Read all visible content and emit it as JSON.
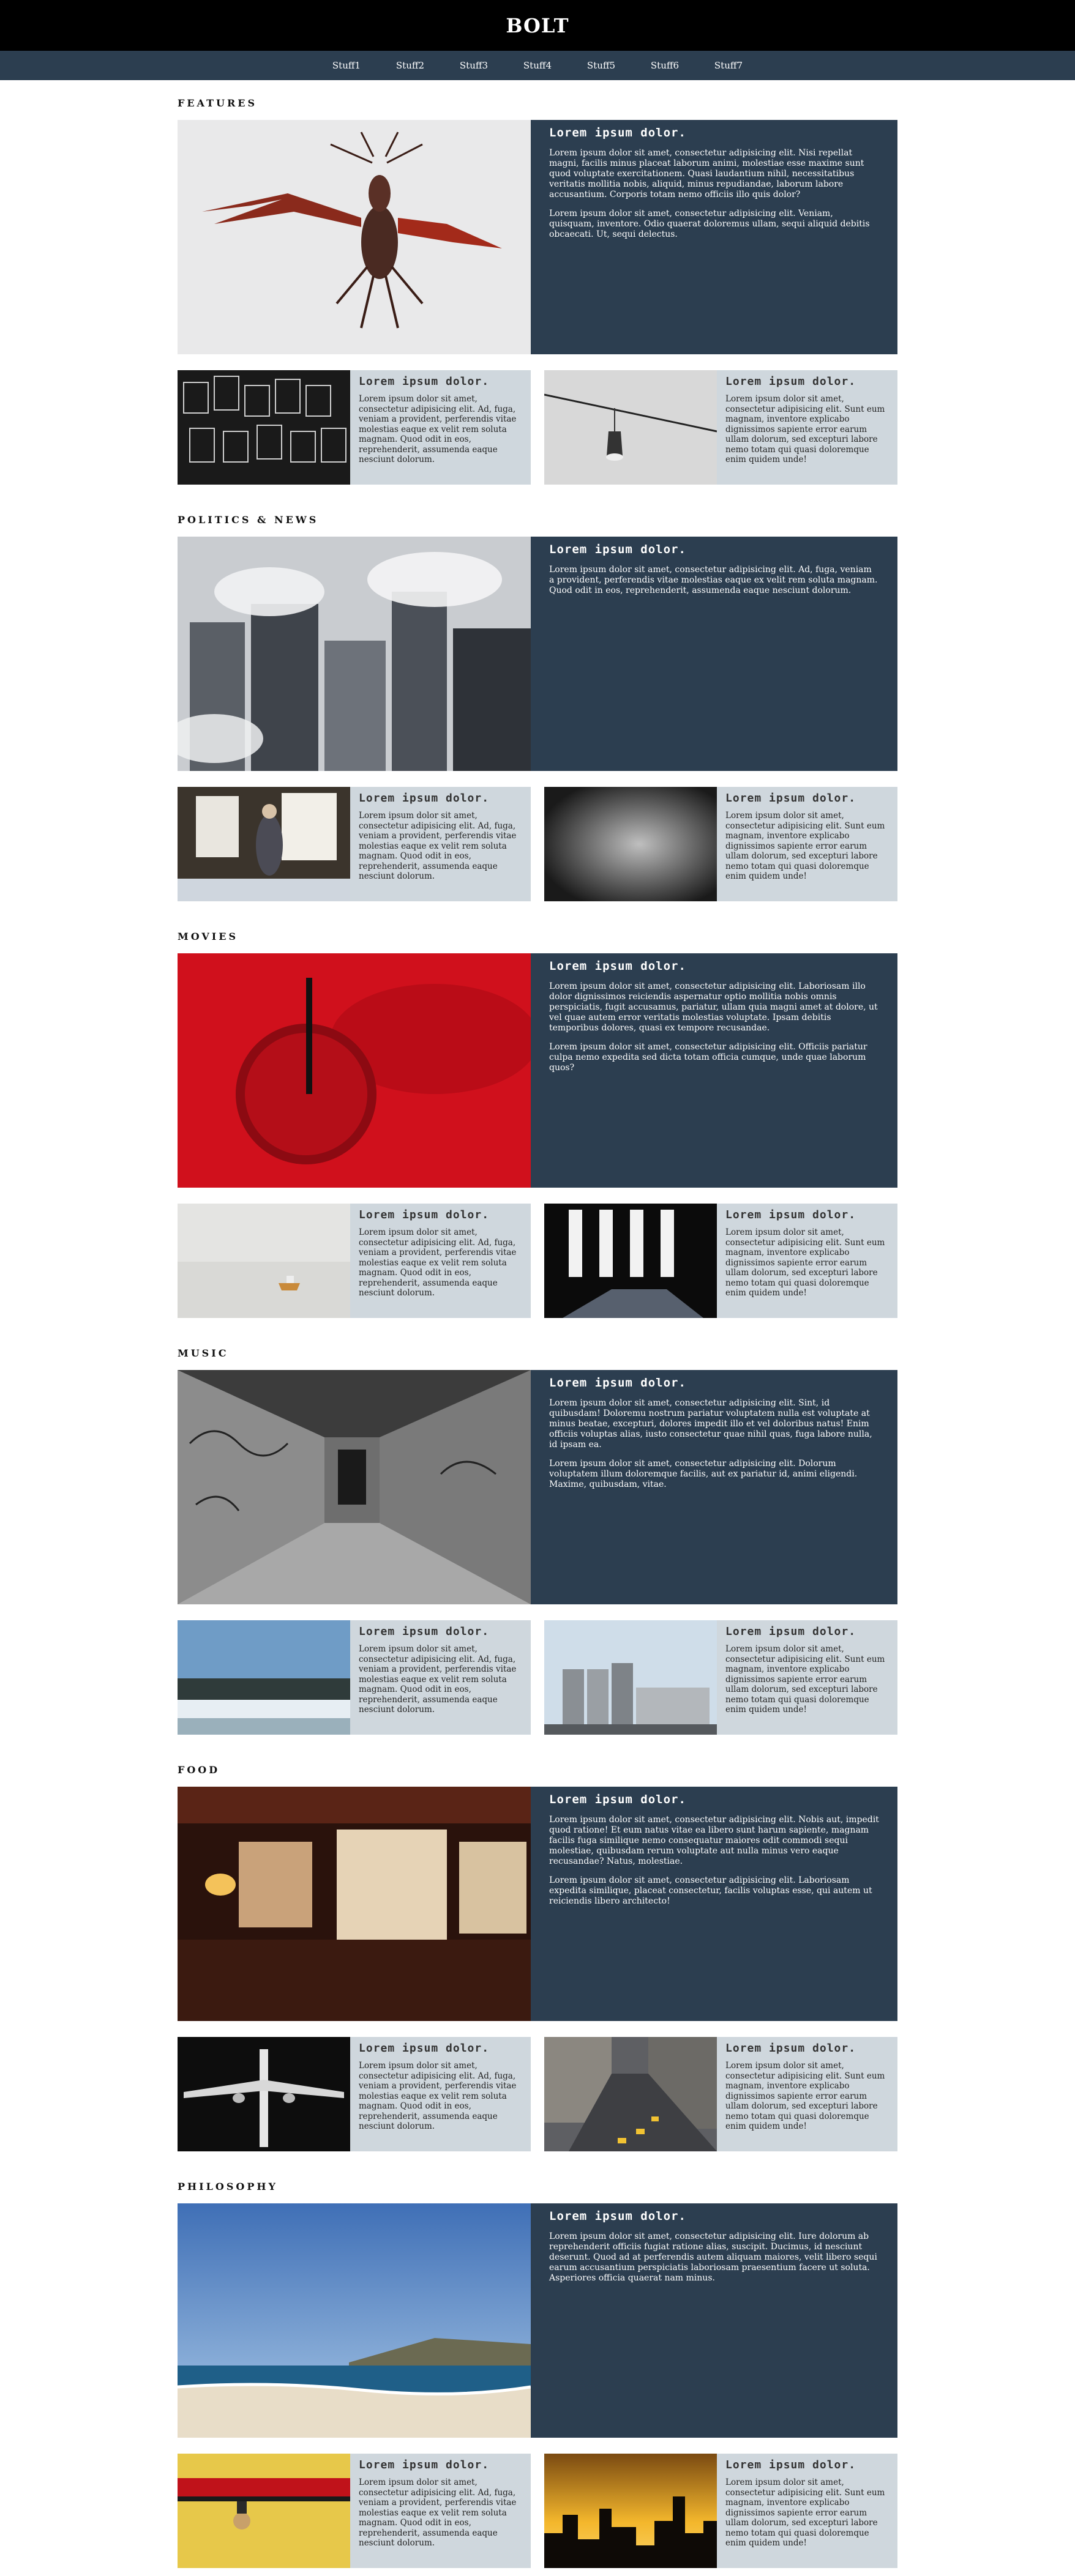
{
  "brand": "BOLT",
  "nav": [
    "Stuff1",
    "Stuff2",
    "Stuff3",
    "Stuff4",
    "Stuff5",
    "Stuff6",
    "Stuff7"
  ],
  "sections": [
    {
      "title": "FEATURES",
      "feature": {
        "heading": "Lorem ipsum dolor.",
        "paragraphs": [
          "Lorem ipsum dolor sit amet, consectetur adipisicing elit. Nisi repellat magni, facilis minus placeat laborum animi, molestiae esse maxime sunt quod voluptate exercitationem. Quasi laudantium nihil, necessitatibus veritatis mollitia nobis, aliquid, minus repudiandae, laborum labore accusantium. Corporis totam nemo officiis illo quis dolor?",
          "Lorem ipsum dolor sit amet, consectetur adipisicing elit. Veniam, quisquam, inventore. Odio quaerat doloremus ullam, sequi aliquid debitis obcaecati. Ut, sequi delectus."
        ]
      },
      "cards": [
        {
          "heading": "Lorem ipsum dolor.",
          "text": "Lorem ipsum dolor sit amet, consectetur adipisicing elit. Ad, fuga, veniam a provident, perferendis vitae molestias eaque ex velit rem soluta magnam. Quod odit in eos, reprehenderit, assumenda eaque nesciunt dolorum."
        },
        {
          "heading": "Lorem ipsum dolor.",
          "text": "Lorem ipsum dolor sit amet, consectetur adipisicing elit. Sunt eum magnam, inventore explicabo dignissimos sapiente error earum ullam dolorum, sed excepturi labore nemo totam qui quasi doloremque enim quidem unde!"
        }
      ]
    },
    {
      "title": "POLITICS & NEWS",
      "feature": {
        "heading": "Lorem ipsum dolor.",
        "paragraphs": [
          "Lorem ipsum dolor sit amet, consectetur adipisicing elit. Ad, fuga, veniam a provident, perferendis vitae molestias eaque ex velit rem soluta magnam. Quod odit in eos, reprehenderit, assumenda eaque nesciunt dolorum."
        ]
      },
      "cards": [
        {
          "heading": "Lorem ipsum dolor.",
          "text": "Lorem ipsum dolor sit amet, consectetur adipisicing elit. Ad, fuga, veniam a provident, perferendis vitae molestias eaque ex velit rem soluta magnam. Quod odit in eos, reprehenderit, assumenda eaque nesciunt dolorum."
        },
        {
          "heading": "Lorem ipsum dolor.",
          "text": "Lorem ipsum dolor sit amet, consectetur adipisicing elit. Sunt eum magnam, inventore explicabo dignissimos sapiente error earum ullam dolorum, sed excepturi labore nemo totam qui quasi doloremque enim quidem unde!"
        }
      ]
    },
    {
      "title": "MOVIES",
      "feature": {
        "heading": "Lorem ipsum dolor.",
        "paragraphs": [
          "Lorem ipsum dolor sit amet, consectetur adipisicing elit. Laboriosam illo dolor dignissimos reiciendis aspernatur optio mollitia nobis omnis perspiciatis, fugit accusamus, pariatur, ullam quia magni amet at dolore, ut vel quae autem error veritatis molestias voluptate. Ipsam debitis temporibus dolores, quasi ex tempore recusandae.",
          "Lorem ipsum dolor sit amet, consectetur adipisicing elit. Officiis pariatur culpa nemo expedita sed dicta totam officia cumque, unde quae laborum quos?"
        ]
      },
      "cards": [
        {
          "heading": "Lorem ipsum dolor.",
          "text": "Lorem ipsum dolor sit amet, consectetur adipisicing elit. Ad, fuga, veniam a provident, perferendis vitae molestias eaque ex velit rem soluta magnam. Quod odit in eos, reprehenderit, assumenda eaque nesciunt dolorum."
        },
        {
          "heading": "Lorem ipsum dolor.",
          "text": "Lorem ipsum dolor sit amet, consectetur adipisicing elit. Sunt eum magnam, inventore explicabo dignissimos sapiente error earum ullam dolorum, sed excepturi labore nemo totam qui quasi doloremque enim quidem unde!"
        }
      ]
    },
    {
      "title": "MUSIC",
      "feature": {
        "heading": "Lorem ipsum dolor.",
        "paragraphs": [
          "Lorem ipsum dolor sit amet, consectetur adipisicing elit. Sint, id quibusdam! Doloremu nostrum pariatur voluptatem nulla est voluptate at minus beatae, excepturi, dolores impedit illo et vel doloribus natus! Enim officiis voluptas alias, iusto consectetur quae nihil quas, fuga labore nulla, id ipsam ea.",
          "Lorem ipsum dolor sit amet, consectetur adipisicing elit. Dolorum voluptatem illum doloremque facilis, aut ex pariatur id, animi eligendi. Maxime, quibusdam, vitae."
        ]
      },
      "cards": [
        {
          "heading": "Lorem ipsum dolor.",
          "text": "Lorem ipsum dolor sit amet, consectetur adipisicing elit. Ad, fuga, veniam a provident, perferendis vitae molestias eaque ex velit rem soluta magnam. Quod odit in eos, reprehenderit, assumenda eaque nesciunt dolorum."
        },
        {
          "heading": "Lorem ipsum dolor.",
          "text": "Lorem ipsum dolor sit amet, consectetur adipisicing elit. Sunt eum magnam, inventore explicabo dignissimos sapiente error earum ullam dolorum, sed excepturi labore nemo totam qui quasi doloremque enim quidem unde!"
        }
      ]
    },
    {
      "title": "FOOD",
      "feature": {
        "heading": "Lorem ipsum dolor.",
        "paragraphs": [
          "Lorem ipsum dolor sit amet, consectetur adipisicing elit. Nobis aut, impedit quod ratione! Et eum natus vitae ea libero sunt harum sapiente, magnam facilis fuga similique nemo consequatur maiores odit commodi sequi molestiae, quibusdam rerum voluptate aut nulla minus vero eaque recusandae? Natus, molestiae.",
          "Lorem ipsum dolor sit amet, consectetur adipisicing elit. Laboriosam expedita similique, placeat consectetur, facilis voluptas esse, qui autem ut reiciendis libero architecto!"
        ]
      },
      "cards": [
        {
          "heading": "Lorem ipsum dolor.",
          "text": "Lorem ipsum dolor sit amet, consectetur adipisicing elit. Ad, fuga, veniam a provident, perferendis vitae molestias eaque ex velit rem soluta magnam. Quod odit in eos, reprehenderit, assumenda eaque nesciunt dolorum."
        },
        {
          "heading": "Lorem ipsum dolor.",
          "text": "Lorem ipsum dolor sit amet, consectetur adipisicing elit. Sunt eum magnam, inventore explicabo dignissimos sapiente error earum ullam dolorum, sed excepturi labore nemo totam qui quasi doloremque enim quidem unde!"
        }
      ]
    },
    {
      "title": "PHILOSOPHY",
      "feature": {
        "heading": "Lorem ipsum dolor.",
        "paragraphs": [
          "Lorem ipsum dolor sit amet, consectetur adipisicing elit. Iure dolorum ab reprehenderit officiis fugiat ratione alias, suscipit. Ducimus, id nesciunt deserunt. Quod ad at perferendis autem aliquam maiores, velit libero sequi earum accusantium perspiciatis laboriosam praesentium facere ut soluta. Asperiores officia quaerat nam minus."
        ]
      },
      "cards": [
        {
          "heading": "Lorem ipsum dolor.",
          "text": "Lorem ipsum dolor sit amet, consectetur adipisicing elit. Ad, fuga, veniam a provident, perferendis vitae molestias eaque ex velit rem soluta magnam. Quod odit in eos, reprehenderit, assumenda eaque nesciunt dolorum."
        },
        {
          "heading": "Lorem ipsum dolor.",
          "text": "Lorem ipsum dolor sit amet, consectetur adipisicing elit. Sunt eum magnam, inventore explicabo dignissimos sapiente error earum ullam dolorum, sed excepturi labore nemo totam qui quasi doloremque enim quidem unde!"
        }
      ]
    }
  ],
  "colors": {
    "header": "#000000",
    "nav": "#2c3e50",
    "feature_panel": "#2c3e50",
    "card_bg": "#cfd7dd"
  },
  "icons": {
    "s0_feature": "lobster-photo",
    "s0_card0": "birdcages-photo",
    "s0_card1": "hanging-shoe-photo",
    "s1_feature": "city-steam-photo",
    "s1_card0": "man-at-window-photo",
    "s1_card1": "wet-pavement-photo",
    "s2_feature": "red-drink-photo",
    "s2_card0": "boat-fog-photo",
    "s2_card1": "dark-doorway-photo",
    "s3_feature": "graffiti-tunnel-photo",
    "s3_card0": "winter-shore-photo",
    "s3_card1": "industrial-silos-photo",
    "s4_feature": "restaurant-interior-photo",
    "s4_card0": "airplane-photo",
    "s4_card1": "city-street-photo",
    "s5_feature": "beach-photo",
    "s5_card0": "yellow-wall-photo",
    "s5_card1": "sunset-skyline-photo"
  }
}
